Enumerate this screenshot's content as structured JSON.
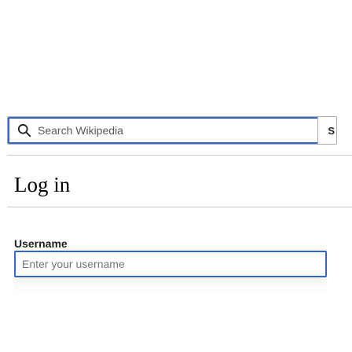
{
  "search": {
    "placeholder": "Search Wikipedia",
    "button_label": "S"
  },
  "page": {
    "title": "Log in"
  },
  "form": {
    "username_label": "Username",
    "username_placeholder": "Enter your username",
    "username_value": ""
  },
  "colors": {
    "accent": "#3366cc",
    "border": "#a2a9b1",
    "text": "#202122",
    "divider": "#c8ccd1"
  },
  "icons": {
    "search": "search-icon"
  }
}
